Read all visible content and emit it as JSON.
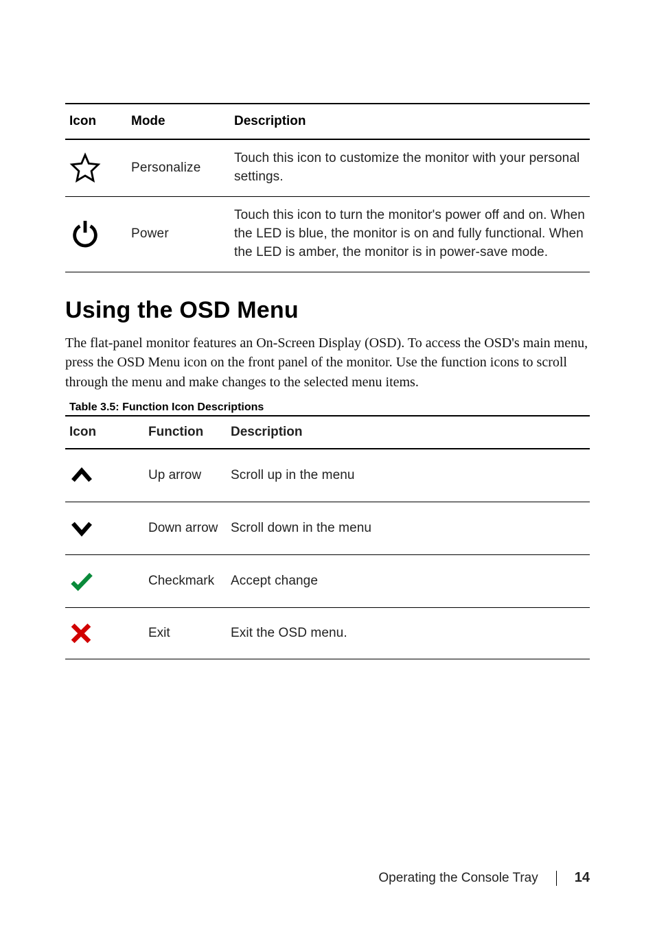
{
  "tableA": {
    "headers": {
      "icon": "Icon",
      "mode": "Mode",
      "description": "Description"
    },
    "rows": [
      {
        "iconName": "star-icon",
        "mode": "Personalize",
        "description": "Touch this icon to customize the monitor with your personal settings."
      },
      {
        "iconName": "power-icon",
        "mode": "Power",
        "description": "Touch this icon to turn the monitor's power off and on. When the LED is blue, the monitor is on and fully functional. When the LED is amber, the monitor is in power-save mode."
      }
    ]
  },
  "section": {
    "title": "Using the OSD Menu",
    "body": "The flat-panel monitor features an On-Screen Display (OSD). To access the OSD's main menu, press the OSD Menu icon on the front panel of the monitor. Use the function icons to scroll through the menu and make changes to the selected menu items."
  },
  "tableB": {
    "caption": "Table 3.5: Function Icon Descriptions",
    "headers": {
      "icon": "Icon",
      "function": "Function",
      "description": "Description"
    },
    "rows": [
      {
        "iconName": "up-arrow-icon",
        "function": "Up arrow",
        "description": "Scroll up in the menu",
        "color": "#000000"
      },
      {
        "iconName": "down-arrow-icon",
        "function": "Down arrow",
        "description": "Scroll down in the menu",
        "color": "#000000"
      },
      {
        "iconName": "checkmark-icon",
        "function": "Checkmark",
        "description": "Accept change",
        "color": "#007a33"
      },
      {
        "iconName": "exit-icon",
        "function": "Exit",
        "description": "Exit the OSD menu.",
        "color": "#d10000"
      }
    ]
  },
  "footer": {
    "chapter": "Operating the Console Tray",
    "page": "14"
  }
}
